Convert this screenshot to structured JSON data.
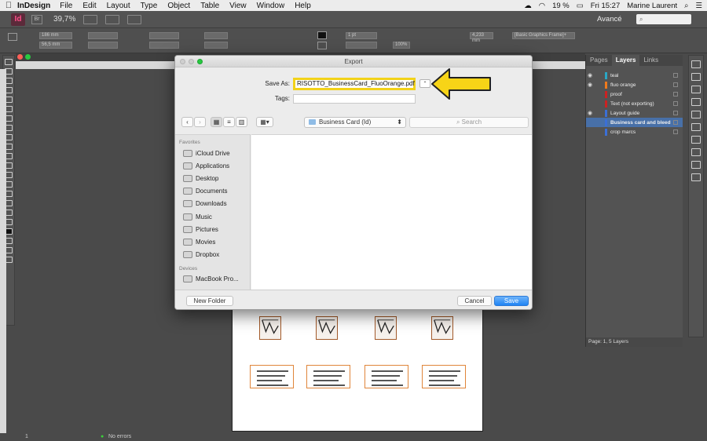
{
  "menubar": {
    "app_name": "InDesign",
    "items": [
      "File",
      "Edit",
      "Layout",
      "Type",
      "Object",
      "Table",
      "View",
      "Window",
      "Help"
    ],
    "battery": "19 %",
    "clock": "Fri 15:27",
    "user": "Marine Laurent"
  },
  "appbar": {
    "logo": "Id",
    "bridge": "Br",
    "zoom": "39,7%",
    "workspace": "Avancé"
  },
  "controlpanel": {
    "x": "186 mm",
    "y": "56,5 mm",
    "stroke_weight": "1 pt",
    "spacing": "4,233 mm",
    "opacity": "100%",
    "frame_style": "[Basic Graphics Frame]+"
  },
  "dialog": {
    "title": "Export",
    "save_as_label": "Save As:",
    "filename": "RISOTTO_BusinessCard_FluoOrange.pdf",
    "tags_label": "Tags:",
    "location": "Business Card (Id)",
    "search_placeholder": "Search",
    "favorites_header": "Favorites",
    "favorites": [
      "iCloud Drive",
      "Applications",
      "Desktop",
      "Documents",
      "Downloads",
      "Music",
      "Pictures",
      "Movies",
      "Dropbox"
    ],
    "devices_header": "Devices",
    "devices": [
      "MacBook Pro..."
    ],
    "new_folder": "New Folder",
    "cancel": "Cancel",
    "save": "Save"
  },
  "layers_panel": {
    "tabs": [
      "Pages",
      "Layers",
      "Links"
    ],
    "layers": [
      {
        "name": "teal",
        "color": "#2aa7c4",
        "visible": true,
        "selected": false
      },
      {
        "name": "fluo orange",
        "color": "#f07a1c",
        "visible": true,
        "selected": false
      },
      {
        "name": "proof",
        "color": "#cc2222",
        "visible": false,
        "selected": false
      },
      {
        "name": "Text (not exporting)",
        "color": "#cc2222",
        "visible": false,
        "selected": false
      },
      {
        "name": "Layout guide",
        "color": "#3b6fd6",
        "visible": true,
        "selected": false
      },
      {
        "name": "Business card and bleed",
        "color": "#3b6fd6",
        "visible": false,
        "selected": true
      },
      {
        "name": "crop marcs",
        "color": "#3b6fd6",
        "visible": false,
        "selected": false
      }
    ],
    "footer": "Page: 1, 5 Layers"
  },
  "statusbar": {
    "page": "1",
    "errors": "No errors"
  },
  "colors": {
    "highlight": "#f2d21a",
    "save_button": "#1f84f4"
  }
}
